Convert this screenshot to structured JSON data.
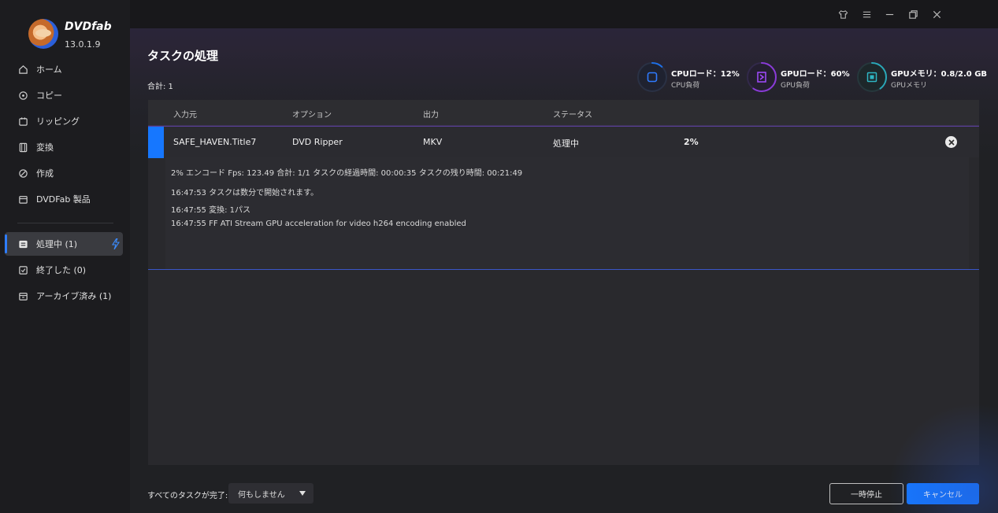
{
  "app": {
    "brand": "DVDfab",
    "version": "13.0.1.9"
  },
  "sidebar": {
    "items": [
      {
        "label": "ホーム",
        "icon": "home-icon"
      },
      {
        "label": "コピー",
        "icon": "copy-icon"
      },
      {
        "label": "リッピング",
        "icon": "ripping-icon"
      },
      {
        "label": "変換",
        "icon": "convert-icon"
      },
      {
        "label": "作成",
        "icon": "create-icon"
      },
      {
        "label": "DVDFab 製品",
        "icon": "products-icon"
      }
    ],
    "queue": [
      {
        "label": "処理中 (1)",
        "icon": "processing-icon",
        "active": true
      },
      {
        "label": "終了した (0)",
        "icon": "finished-icon"
      },
      {
        "label": "アーカイブ済み (1)",
        "icon": "archive-icon"
      }
    ]
  },
  "header": {
    "title": "タスクの処理",
    "total": "合計: 1"
  },
  "stats": [
    {
      "title": "CPUロード：12%",
      "sub": "CPU負荷",
      "percent": 12,
      "color": "#1e6fe6",
      "icon": "cpu-icon"
    },
    {
      "title": "GPUロード：60%",
      "sub": "GPU負荷",
      "percent": 60,
      "color": "#8a3bd8",
      "icon": "gpu-icon"
    },
    {
      "title": "GPUメモリ：0.8/2.0 GB",
      "sub": "GPUメモリ",
      "percent": 40,
      "color": "#2aa7b8",
      "icon": "gpu-memory-icon"
    }
  ],
  "table": {
    "columns": [
      "入力元",
      "オプション",
      "出力",
      "ステータス"
    ],
    "row": {
      "source": "SAFE_HAVEN.Title7",
      "option": "DVD Ripper",
      "output": "MKV",
      "status": "処理中",
      "progress": "2%"
    },
    "log": [
      "2%  エンコード Fps: 123.49   合計: 1/1  タスクの経過時間: 00:00:35  タスクの残り時間: 00:21:49",
      "16:47:53  タスクは数分で開始されます。",
      "16:47:55  変換: 1パス",
      "16:47:55  FF ATI Stream GPU acceleration for video h264 encoding enabled"
    ]
  },
  "footer": {
    "label": "すべてのタスクが完了:",
    "select_value": "何もしません",
    "pause_label": "一時停止",
    "cancel_label": "キャンセル"
  },
  "colors": {
    "accent": "#1677ff"
  }
}
